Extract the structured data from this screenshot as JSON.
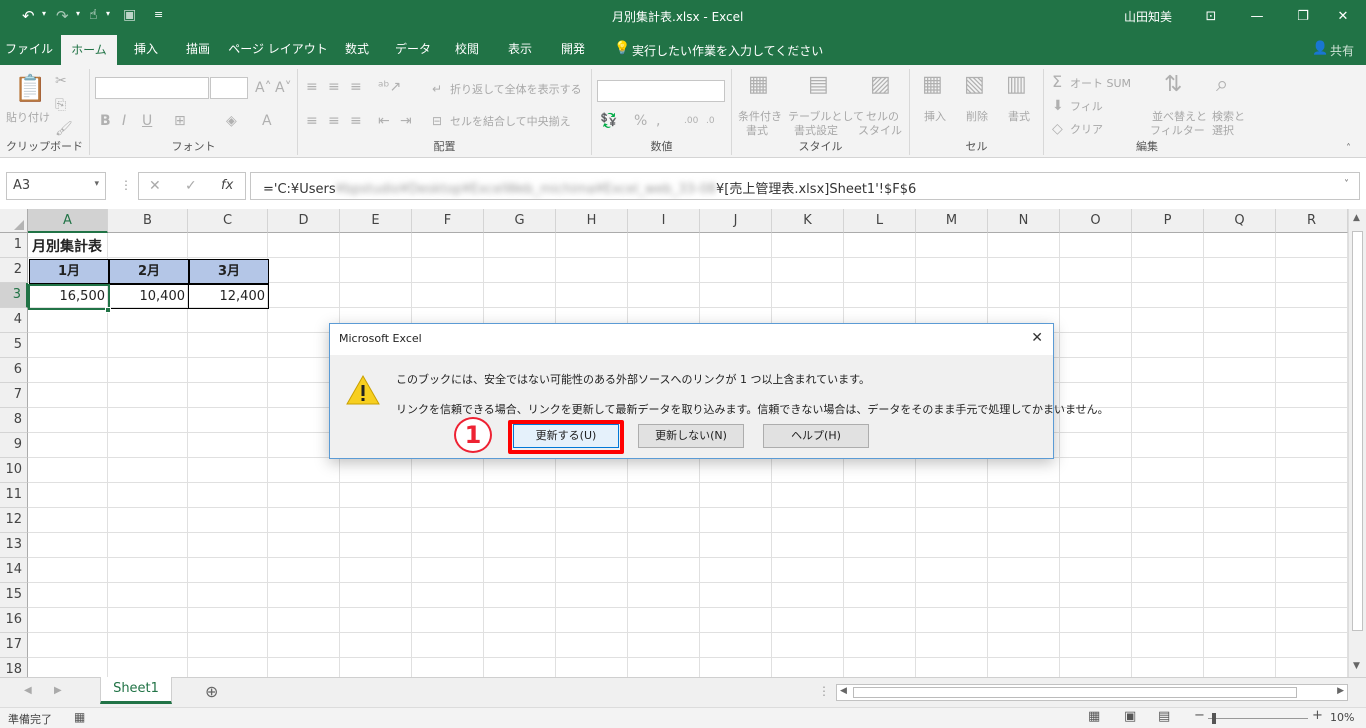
{
  "window": {
    "title": "月別集計表.xlsx  -  Excel",
    "user": "山田知美"
  },
  "tabs": [
    "ファイル",
    "ホーム",
    "挿入",
    "描画",
    "ページ レイアウト",
    "数式",
    "データ",
    "校閲",
    "表示",
    "開発"
  ],
  "tell_me": "実行したい作業を入力してください",
  "share": "共有",
  "ribbon": {
    "clipboard": {
      "paste": "貼り付け",
      "label": "クリップボード"
    },
    "font": {
      "label": "フォント"
    },
    "alignment": {
      "wrap": "折り返して全体を表示する",
      "merge": "セルを結合して中央揃え",
      "label": "配置"
    },
    "number": {
      "label": "数値"
    },
    "styles": {
      "conditional_1": "条件付き",
      "conditional_2": "書式",
      "table_1": "テーブルとして",
      "table_2": "書式設定",
      "cell_1": "セルの",
      "cell_2": "スタイル",
      "label": "スタイル"
    },
    "cells": {
      "insert": "挿入",
      "delete": "削除",
      "format": "書式",
      "label": "セル"
    },
    "editing": {
      "autosum": "オート SUM",
      "fill": "フィル",
      "clear": "クリア",
      "sort_1": "並べ替えと",
      "sort_2": "フィルター",
      "find_1": "検索と",
      "find_2": "選択",
      "label": "編集"
    }
  },
  "formula_bar": {
    "name_box": "A3",
    "formula_prefix": "='C:¥Users",
    "formula_hidden": "¥bpstudio¥Desktop¥ExcelWeb_michima¥Excel_web_33-08",
    "formula_suffix": "¥[売上管理表.xlsx]Sheet1'!$F$6"
  },
  "grid": {
    "columns": [
      "A",
      "B",
      "C",
      "D",
      "E",
      "F",
      "G",
      "H",
      "I",
      "J",
      "K",
      "L",
      "M",
      "N",
      "O",
      "P",
      "Q",
      "R"
    ],
    "rows": [
      "1",
      "2",
      "3",
      "4",
      "5",
      "6",
      "7",
      "8",
      "9",
      "10",
      "11",
      "12",
      "13",
      "14",
      "15",
      "16",
      "17",
      "18"
    ],
    "a1": "月別集計表",
    "headers": [
      "1月",
      "2月",
      "3月"
    ],
    "values": [
      "16,500",
      "10,400",
      "12,400"
    ],
    "header_fill": "#b4c6e7"
  },
  "sheet_tab": "Sheet1",
  "status": {
    "ready": "準備完了",
    "zoom": "10%"
  },
  "dialog": {
    "title": "Microsoft Excel",
    "message_1": "このブックには、安全ではない可能性のある外部ソースへのリンクが 1 つ以上含まれています。",
    "message_2": "リンクを信頼できる場合、リンクを更新して最新データを取り込みます。信頼できない場合は、データをそのまま手元で処理してかまいません。",
    "update": "更新する(U)",
    "dont_update": "更新しない(N)",
    "help": "ヘルプ(H)",
    "step_marker": "1",
    "highlight_color": "#ff0000"
  },
  "colors": {
    "excel_green": "#217346"
  }
}
